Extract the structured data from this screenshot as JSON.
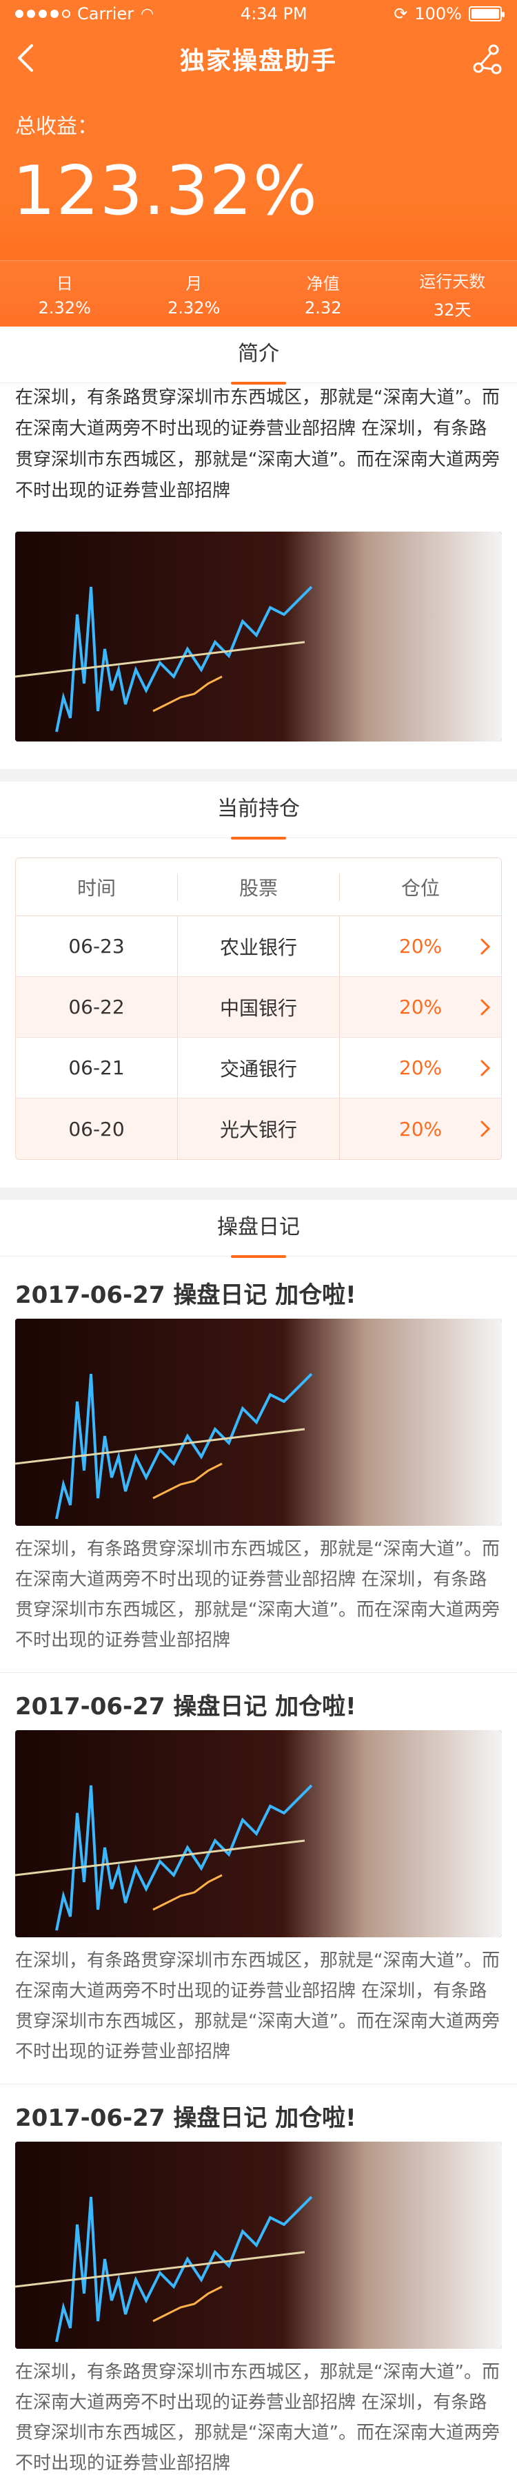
{
  "status": {
    "carrier": "Carrier",
    "time": "4:34 PM",
    "battery": "100%"
  },
  "nav": {
    "title": "独家操盘助手"
  },
  "summary": {
    "label": "总收益：",
    "value": "123.32%"
  },
  "stats": [
    {
      "label": "日",
      "value": "2.32%"
    },
    {
      "label": "月",
      "value": "2.32%"
    },
    {
      "label": "净值",
      "value": "2.32"
    },
    {
      "label": "运行天数",
      "value": "32天"
    }
  ],
  "sections": {
    "intro": "简介",
    "holdings": "当前持仓",
    "diary": "操盘日记"
  },
  "intro": {
    "text": "在深圳，有条路贯穿深圳市东西城区，那就是“深南大道”。而在深南大道两旁不时出现的证券营业部招牌 在深圳，有条路贯穿深圳市东西城区，那就是“深南大道”。而在深南大道两旁不时出现的证券营业部招牌"
  },
  "holdings": {
    "headers": [
      "时间",
      "股票",
      "仓位"
    ],
    "rows": [
      {
        "date": "06-23",
        "stock": "农业银行",
        "pct": "20%"
      },
      {
        "date": "06-22",
        "stock": "中国银行",
        "pct": "20%"
      },
      {
        "date": "06-21",
        "stock": "交通银行",
        "pct": "20%"
      },
      {
        "date": "06-20",
        "stock": "光大银行",
        "pct": "20%"
      }
    ]
  },
  "diary": [
    {
      "title": "2017-06-27 操盘日记   加仓啦!",
      "text": "在深圳，有条路贯穿深圳市东西城区，那就是“深南大道”。而在深南大道两旁不时出现的证券营业部招牌 在深圳，有条路贯穿深圳市东西城区，那就是“深南大道”。而在深南大道两旁不时出现的证券营业部招牌"
    },
    {
      "title": "2017-06-27 操盘日记   加仓啦!",
      "text": "在深圳，有条路贯穿深圳市东西城区，那就是“深南大道”。而在深南大道两旁不时出现的证券营业部招牌 在深圳，有条路贯穿深圳市东西城区，那就是“深南大道”。而在深南大道两旁不时出现的证券营业部招牌"
    },
    {
      "title": "2017-06-27 操盘日记   加仓啦!",
      "text": "在深圳，有条路贯穿深圳市东西城区，那就是“深南大道”。而在深南大道两旁不时出现的证券营业部招牌 在深圳，有条路贯穿深圳市东西城区，那就是“深南大道”。而在深南大道两旁不时出现的证券营业部招牌"
    }
  ],
  "colors": {
    "accent": "#ff6a1b",
    "header": "#ff7a2a",
    "separator": "#f2f2f2"
  },
  "icons": {
    "back": "chevron-left-icon",
    "share": "share-icon",
    "row": "chevron-right-icon"
  }
}
